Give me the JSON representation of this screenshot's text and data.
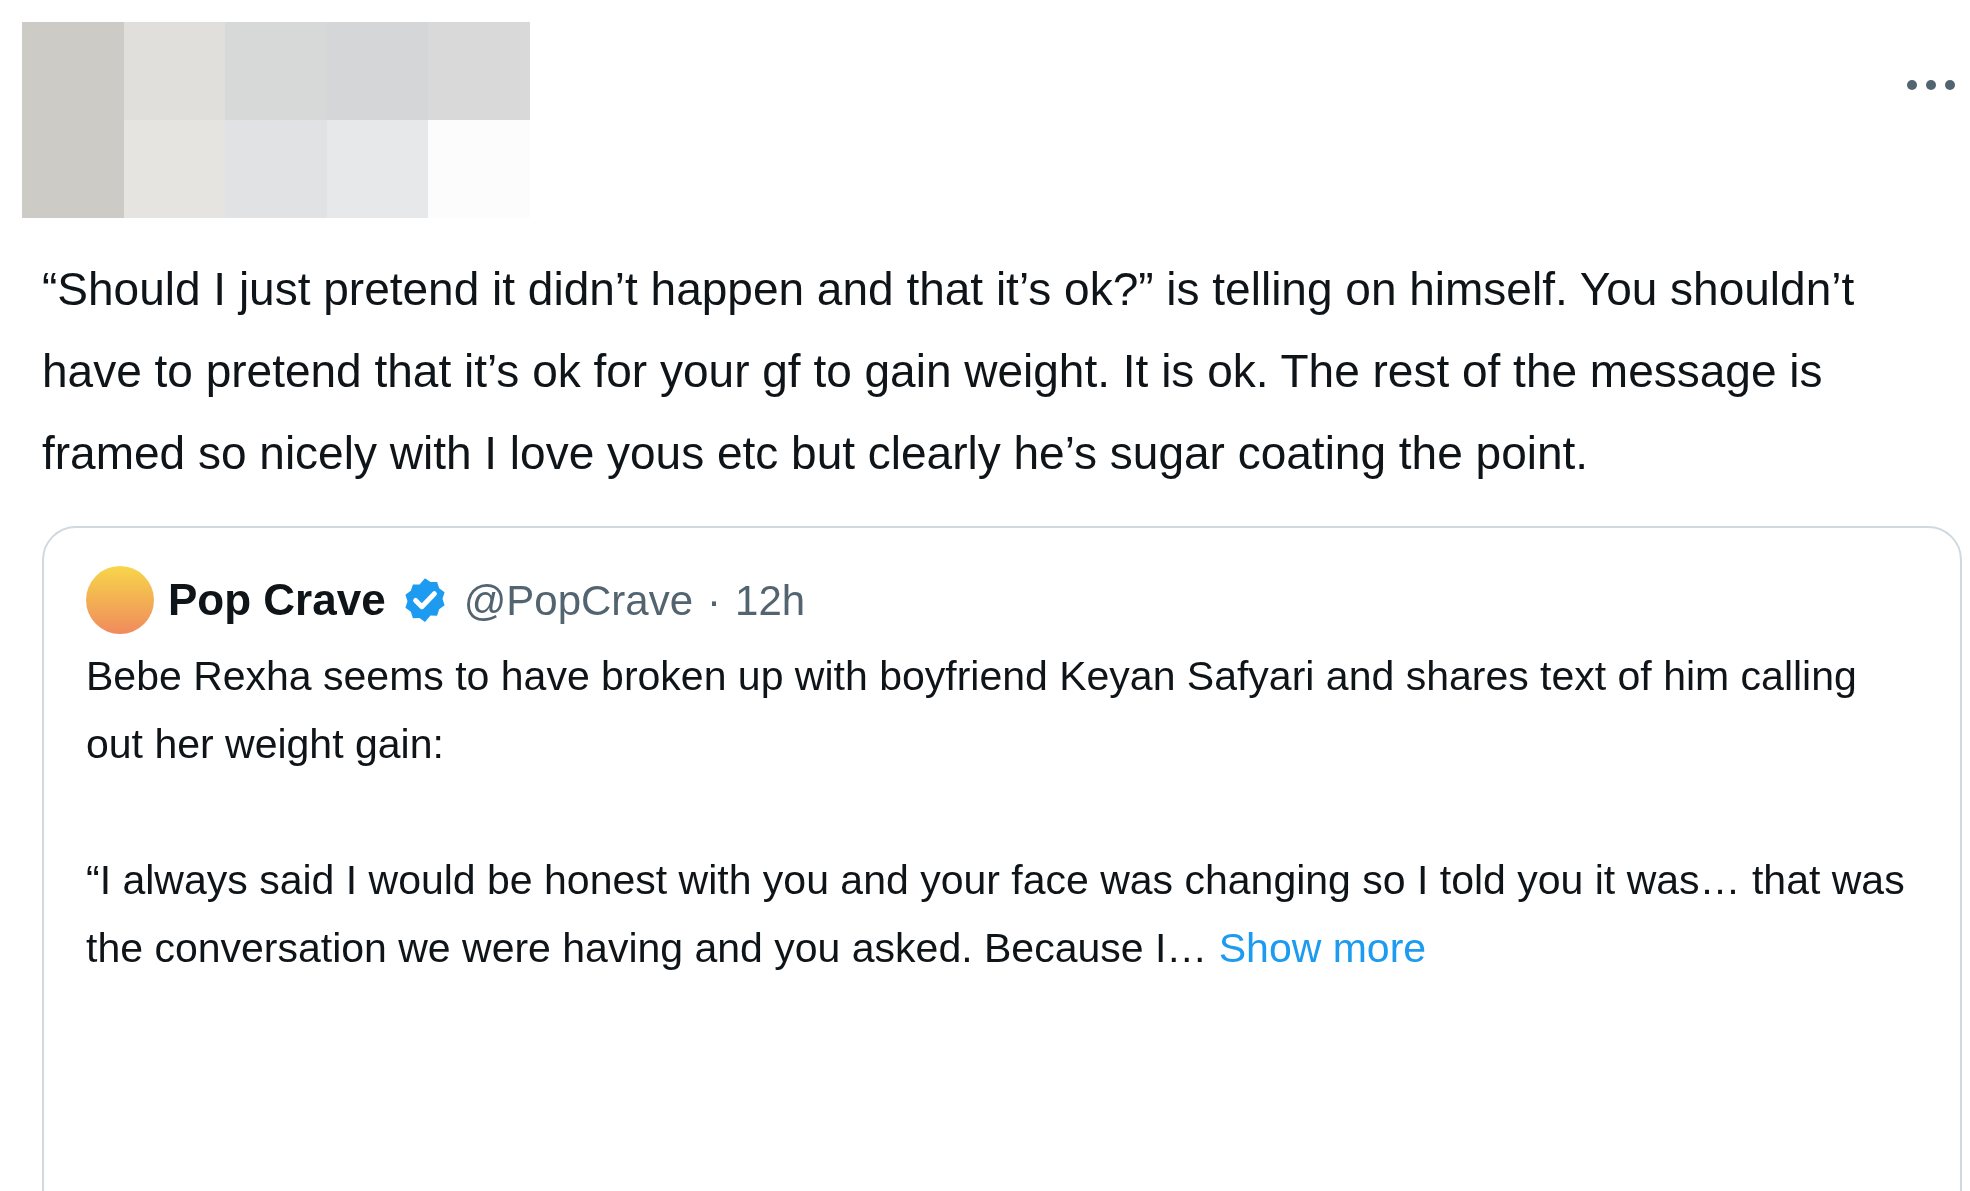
{
  "tweet": {
    "text": "“Should I just pretend it didn’t happen and that it’s ok?” is telling on himself. You shouldn’t have to pretend that it’s ok for your gf to gain weight. It is ok. The rest of the message is framed so nicely with I love yous etc but clearly he’s sugar coating the point.",
    "quoted_tweet": {
      "author_name": "Pop Crave",
      "verified": true,
      "handle": "@PopCrave",
      "separator": "·",
      "time": "12h",
      "paragraphs": [
        "Bebe Rexha seems to have broken up with boyfriend Keyan Safyari and shares text of him calling out her weight gain:",
        "“I always said I would be honest with you and your face was changing so I told you it was… that was the conversation we were having and you asked. Because I…"
      ],
      "show_more": "Show more"
    }
  }
}
